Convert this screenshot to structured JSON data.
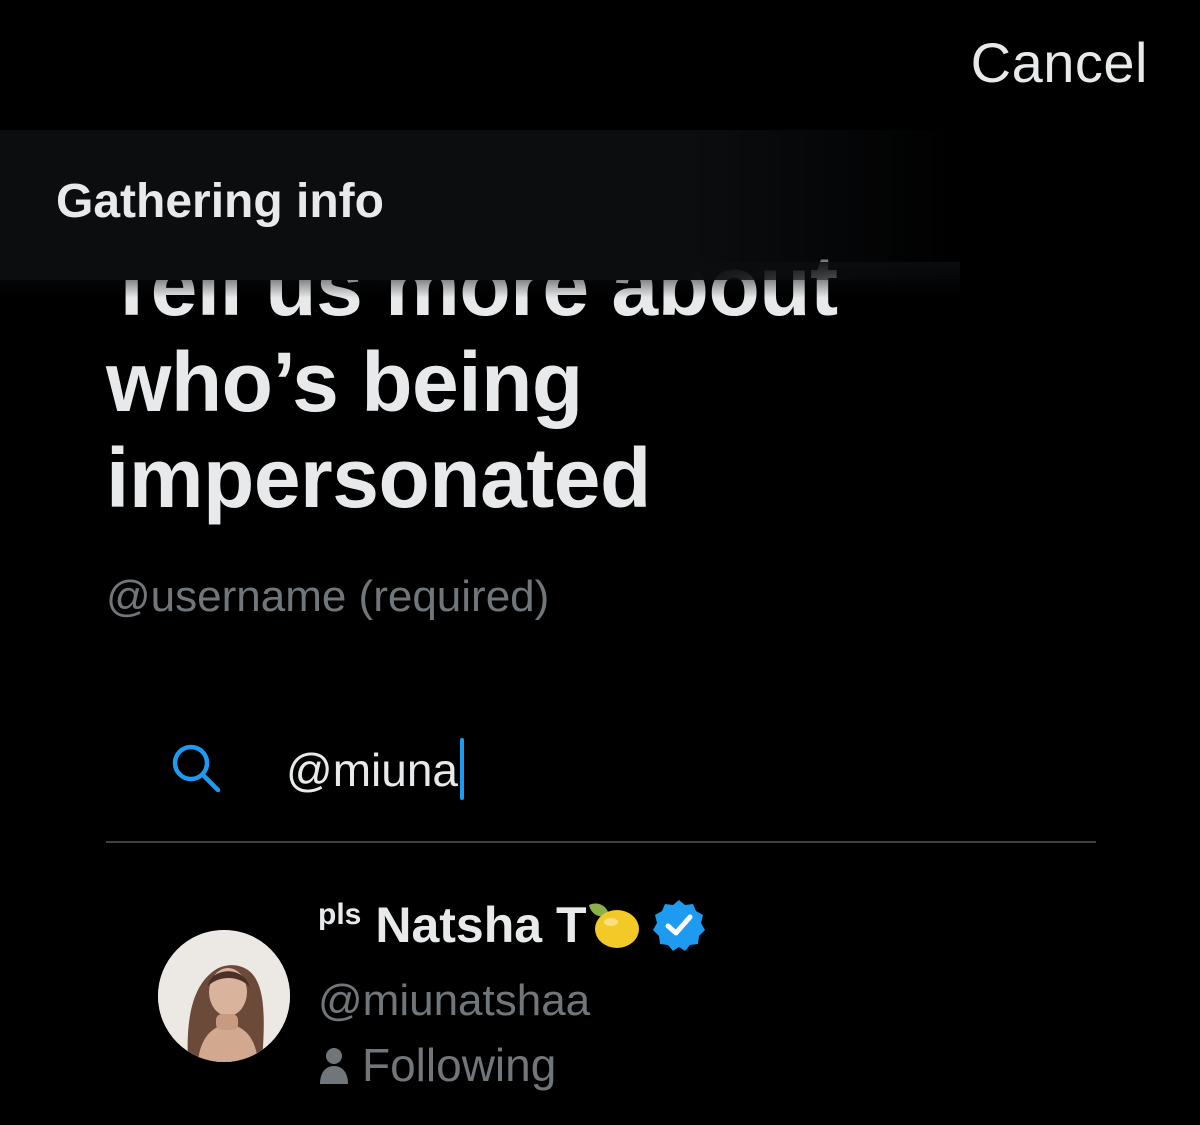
{
  "header": {
    "cancel_label": "Cancel"
  },
  "status_banner": {
    "text": "Gathering info"
  },
  "main": {
    "heading_line1": "Tell us more about",
    "heading_line2": "who’s being",
    "heading_line3": "impersonated",
    "field_label": "@username (required)"
  },
  "search": {
    "value": "@miuna",
    "icon": "search-icon",
    "accent_color": "#1d9bf0"
  },
  "result": {
    "name_prefix": "pls",
    "name": "Natsha T",
    "name_emoji": "lemon-icon",
    "verified": true,
    "handle": "@miunatshaa",
    "relationship": "Following"
  },
  "colors": {
    "background": "#000000",
    "primary_text": "#e7e9ea",
    "secondary_text": "#71767b",
    "divider": "#3e4144",
    "accent": "#1d9bf0"
  }
}
